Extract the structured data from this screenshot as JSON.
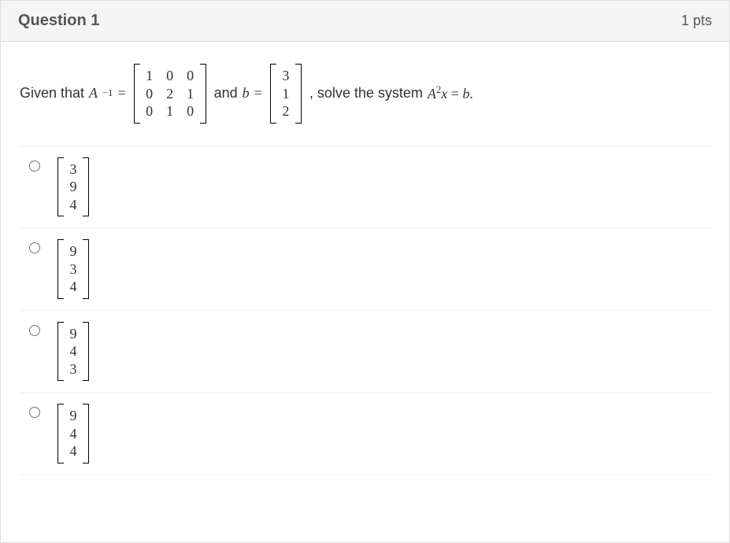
{
  "header": {
    "title": "Question 1",
    "points": "1 pts"
  },
  "prompt": {
    "lead": "Given that ",
    "var_A": "A",
    "exp_neg1": "−1",
    "equals": " = ",
    "matrix_A_inv": [
      [
        "1",
        "0",
        "0"
      ],
      [
        "0",
        "2",
        "1"
      ],
      [
        "0",
        "1",
        "0"
      ]
    ],
    "and_b": " and ",
    "var_b": "b",
    "vector_b": [
      "3",
      "1",
      "2"
    ],
    "solve_text": ", solve the system ",
    "eq_A": "A",
    "eq_sq": "2",
    "eq_x": "x",
    "eq_eq": " = ",
    "eq_b": "b",
    "period": "."
  },
  "options": [
    {
      "vector": [
        "3",
        "9",
        "4"
      ]
    },
    {
      "vector": [
        "9",
        "3",
        "4"
      ]
    },
    {
      "vector": [
        "9",
        "4",
        "3"
      ]
    },
    {
      "vector": [
        "9",
        "4",
        "4"
      ]
    }
  ]
}
